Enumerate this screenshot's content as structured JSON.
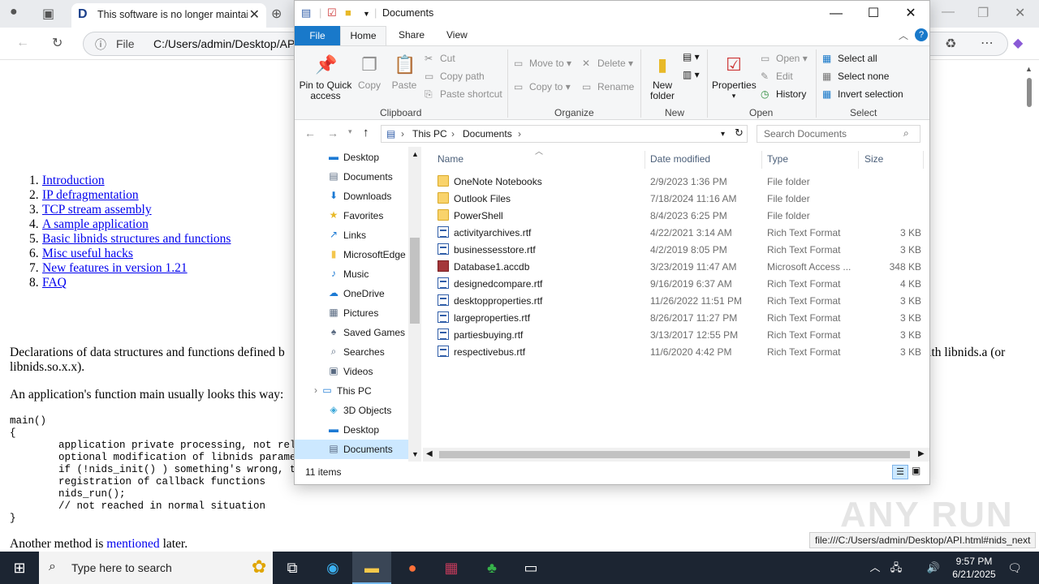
{
  "browser": {
    "tab_title": "This software is no longer maintai",
    "address_prefix": "File",
    "address_url": "C:/Users/admin/Desktop/API",
    "status_url": "file:///C:/Users/admin/Desktop/API.html#nids_next"
  },
  "doc": {
    "toc": [
      {
        "num": "1.",
        "label": "Introduction"
      },
      {
        "num": "2.",
        "label": "IP defragmentation"
      },
      {
        "num": "3.",
        "label": "TCP stream assembly"
      },
      {
        "num": "4.",
        "label": "A sample application"
      },
      {
        "num": "5.",
        "label": "Basic libnids structures and functions"
      },
      {
        "num": "6.",
        "label": "Misc useful hacks"
      },
      {
        "num": "7.",
        "label": "New features in version 1.21"
      },
      {
        "num": "8.",
        "label": "FAQ"
      }
    ],
    "para1": "Declarations of data structures and functions defined b",
    "para1_tail": "with libnids.a (or",
    "para1_line2": "libnids.so.x.x).",
    "para2": "An application's function main usually looks this way:",
    "code": "main()\n{\n        application private processing, not relat\n        optional modification of libnids paramete\n        if (!nids_init() ) something's wrong, ter\n        registration of callback functions\n        nids_run();\n        // not reached in normal situation\n}",
    "para3_before": "Another method is ",
    "para3_link": "mentioned",
    "para3_after": " later."
  },
  "explorer": {
    "title": "Documents",
    "ribbon_tabs": {
      "file": "File",
      "home": "Home",
      "share": "Share",
      "view": "View"
    },
    "clipboard": {
      "pin": "Pin to Quick access",
      "copy": "Copy",
      "paste": "Paste",
      "cut": "Cut",
      "copy_path": "Copy path",
      "paste_shortcut": "Paste shortcut",
      "label": "Clipboard"
    },
    "organize": {
      "move_to": "Move to",
      "copy_to": "Copy to",
      "delete": "Delete",
      "rename": "Rename",
      "label": "Organize"
    },
    "new": {
      "new_folder": "New folder",
      "label": "New"
    },
    "open": {
      "properties": "Properties",
      "open": "Open",
      "edit": "Edit",
      "history": "History",
      "label": "Open"
    },
    "select": {
      "select_all": "Select all",
      "select_none": "Select none",
      "invert": "Invert selection",
      "label": "Select"
    },
    "breadcrumb": [
      "This PC",
      "Documents"
    ],
    "search_placeholder": "Search Documents",
    "nav": [
      {
        "label": "Desktop",
        "icon": "desktop-icon"
      },
      {
        "label": "Documents",
        "icon": "documents-icon"
      },
      {
        "label": "Downloads",
        "icon": "downloads-icon"
      },
      {
        "label": "Favorites",
        "icon": "star-icon"
      },
      {
        "label": "Links",
        "icon": "links-icon"
      },
      {
        "label": "MicrosoftEdge",
        "icon": "folder-icon"
      },
      {
        "label": "Music",
        "icon": "music-icon"
      },
      {
        "label": "OneDrive",
        "icon": "onedrive-icon"
      },
      {
        "label": "Pictures",
        "icon": "pictures-icon"
      },
      {
        "label": "Saved Games",
        "icon": "saved-games-icon"
      },
      {
        "label": "Searches",
        "icon": "search-icon"
      },
      {
        "label": "Videos",
        "icon": "videos-icon"
      },
      {
        "label": "This PC",
        "icon": "this-pc-icon"
      },
      {
        "label": "3D Objects",
        "icon": "3d-objects-icon"
      },
      {
        "label": "Desktop",
        "icon": "desktop-icon"
      },
      {
        "label": "Documents",
        "icon": "documents-icon"
      }
    ],
    "columns": {
      "name": "Name",
      "date": "Date modified",
      "type": "Type",
      "size": "Size"
    },
    "files": [
      {
        "name": "OneNote Notebooks",
        "date": "2/9/2023 1:36 PM",
        "type": "File folder",
        "size": "",
        "kind": "folder"
      },
      {
        "name": "Outlook Files",
        "date": "7/18/2024 11:16 AM",
        "type": "File folder",
        "size": "",
        "kind": "folder"
      },
      {
        "name": "PowerShell",
        "date": "8/4/2023 6:25 PM",
        "type": "File folder",
        "size": "",
        "kind": "folder"
      },
      {
        "name": "activityarchives.rtf",
        "date": "4/22/2021 3:14 AM",
        "type": "Rich Text Format",
        "size": "3 KB",
        "kind": "rtf"
      },
      {
        "name": "businessesstore.rtf",
        "date": "4/2/2019 8:05 PM",
        "type": "Rich Text Format",
        "size": "3 KB",
        "kind": "rtf"
      },
      {
        "name": "Database1.accdb",
        "date": "3/23/2019 11:47 AM",
        "type": "Microsoft Access ...",
        "size": "348 KB",
        "kind": "access"
      },
      {
        "name": "designedcompare.rtf",
        "date": "9/16/2019 6:37 AM",
        "type": "Rich Text Format",
        "size": "4 KB",
        "kind": "rtf"
      },
      {
        "name": "desktopproperties.rtf",
        "date": "11/26/2022 11:51 PM",
        "type": "Rich Text Format",
        "size": "3 KB",
        "kind": "rtf"
      },
      {
        "name": "largeproperties.rtf",
        "date": "8/26/2017 11:27 PM",
        "type": "Rich Text Format",
        "size": "3 KB",
        "kind": "rtf"
      },
      {
        "name": "partiesbuying.rtf",
        "date": "3/13/2017 12:55 PM",
        "type": "Rich Text Format",
        "size": "3 KB",
        "kind": "rtf"
      },
      {
        "name": "respectivebus.rtf",
        "date": "11/6/2020 4:42 PM",
        "type": "Rich Text Format",
        "size": "3 KB",
        "kind": "rtf"
      }
    ],
    "status": "11 items"
  },
  "taskbar": {
    "search_placeholder": "Type here to search",
    "time": "9:57 PM",
    "date": "6/21/2025"
  },
  "watermark": "ANY RUN"
}
